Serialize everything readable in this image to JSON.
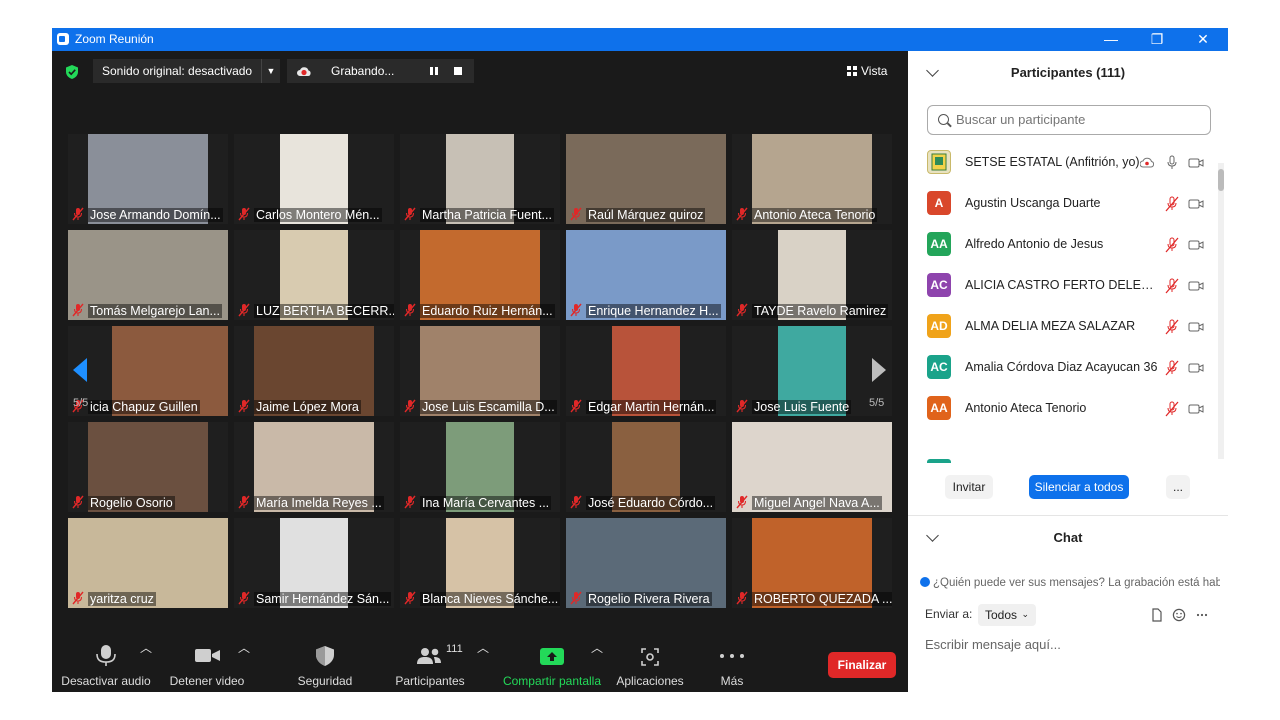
{
  "window": {
    "title": "Zoom Reunión",
    "minimize_glyph": "—",
    "restore_glyph": "❐",
    "close_glyph": "✕"
  },
  "topbar": {
    "shield_icon": "security-shield-icon",
    "sonido_label": "Sonido original: desactivado",
    "recording_label": "Grabando...",
    "vista_label": "Vista"
  },
  "pager": {
    "left": "5/5",
    "right": "5/5"
  },
  "tiles": [
    {
      "name": "Jose Armando Domín...",
      "bg": "#8a8f99"
    },
    {
      "name": "Carlos Montero  Mén...",
      "bg": "#e8e4dc"
    },
    {
      "name": "Martha Patricia Fuent...",
      "bg": "#c7c0b5"
    },
    {
      "name": "Raúl Márquez quiroz",
      "bg": "#7a6a5a"
    },
    {
      "name": "Antonio Ateca Tenorio",
      "bg": "#b5a58f"
    },
    {
      "name": "Tomás Melgarejo Lan...",
      "bg": "#9a9488"
    },
    {
      "name": "LUZ BERTHA BECERR...",
      "bg": "#d8cbb0"
    },
    {
      "name": "Eduardo Ruiz Hernán...",
      "bg": "#c36a2e"
    },
    {
      "name": "Enrique Hernandez H...",
      "bg": "#7a9ac8"
    },
    {
      "name": "TAYDE Ravelo Ramirez",
      "bg": "#d9d2c6"
    },
    {
      "name": "icia Chapuz Guillen",
      "bg": "#8c5a3e"
    },
    {
      "name": "Jaime López Mora",
      "bg": "#6a4630"
    },
    {
      "name": "Jose Luis Escamilla D...",
      "bg": "#a0826a"
    },
    {
      "name": "Edgar Martin Hernán...",
      "bg": "#b8533a"
    },
    {
      "name": "Jose Luis Fuente",
      "bg": "#3fa9a0"
    },
    {
      "name": "Rogelio Osorio",
      "bg": "#6b5040"
    },
    {
      "name": "María Imelda Reyes ...",
      "bg": "#c9b9a8"
    },
    {
      "name": "Ina María Cervantes ...",
      "bg": "#7d9c7a"
    },
    {
      "name": "José Eduardo Córdo...",
      "bg": "#8a6040"
    },
    {
      "name": "Miguel Angel Nava A...",
      "bg": "#ddd5cc"
    },
    {
      "name": "yaritza cruz",
      "bg": "#c8b89a"
    },
    {
      "name": "Samir Hernández Sán...",
      "bg": "#e0e0e0"
    },
    {
      "name": "Blanca Nieves Sánche...",
      "bg": "#d6c2a6"
    },
    {
      "name": "Rogelio Rivera Rivera",
      "bg": "#5b6a78"
    },
    {
      "name": "ROBERTO QUEZADA ...",
      "bg": "#c0622a"
    }
  ],
  "toolbar": {
    "mute": "Desactivar audio",
    "video": "Detener video",
    "security": "Seguridad",
    "participants": "Participantes",
    "participants_count": "111",
    "share": "Compartir pantalla",
    "apps": "Aplicaciones",
    "more": "Más",
    "end": "Finalizar"
  },
  "participants_panel": {
    "title": "Participantes (111)",
    "search_placeholder": "Buscar un participante",
    "list": [
      {
        "name": "SETSE ESTATAL (Anfitrión, yo)",
        "initials": "",
        "color": "#e8e2c0",
        "host": true
      },
      {
        "name": "Agustin Uscanga Duarte",
        "initials": "A",
        "color": "#d9472b"
      },
      {
        "name": "Alfredo Antonio de Jesus",
        "initials": "AA",
        "color": "#23a55a"
      },
      {
        "name": "ALICIA CASTRO FERTO DELEGACION 36",
        "initials": "AC",
        "color": "#8e44ad"
      },
      {
        "name": "ALMA DELIA MEZA SALAZAR",
        "initials": "AD",
        "color": "#f0a31a"
      },
      {
        "name": "Amalia Córdova Diaz Acayucan 36",
        "initials": "AC",
        "color": "#1aa38a"
      },
      {
        "name": "Antonio Ateca Tenorio",
        "initials": "AA",
        "color": "#e0631b"
      }
    ],
    "invite": "Invitar",
    "mute_all": "Silenciar a todos",
    "more": "..."
  },
  "chat": {
    "title": "Chat",
    "notice": "¿Quién puede ver sus mensajes? La grabación está habilitada",
    "send_to_label": "Enviar a:",
    "send_to_value": "Todos",
    "placeholder": "Escribir mensaje aquí..."
  },
  "colors": {
    "accent": "#0e71eb",
    "end": "#e02828",
    "share": "#23d959",
    "muted": "#e02828"
  }
}
